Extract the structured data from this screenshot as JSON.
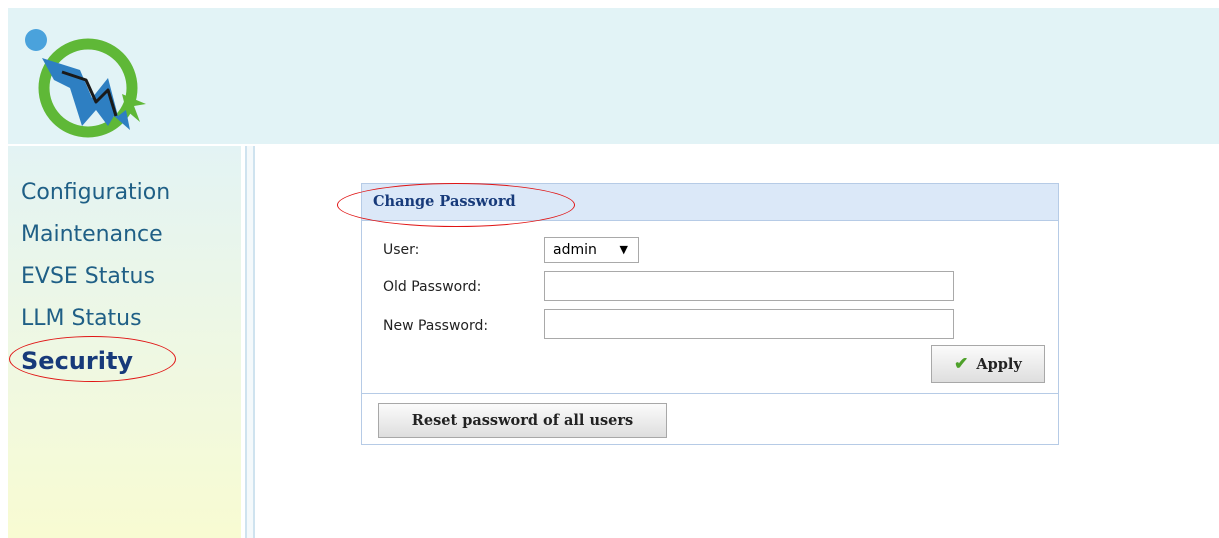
{
  "brand": {
    "logo_icon": "charger-logo-icon",
    "accent": "#173a7a",
    "link": "#1f5f86",
    "highlight": "#e01414"
  },
  "sidebar": {
    "items": [
      {
        "label": "Configuration"
      },
      {
        "label": "Maintenance"
      },
      {
        "label": "EVSE Status"
      },
      {
        "label": "LLM Status"
      },
      {
        "label": "Security",
        "active": true
      }
    ]
  },
  "change_password": {
    "title": "Change Password",
    "user_label": "User:",
    "user_value": "admin",
    "old_password_label": "Old Password:",
    "old_password_value": "",
    "new_password_label": "New Password:",
    "new_password_value": "",
    "apply_label": "Apply",
    "reset_label": "Reset password of all users"
  }
}
